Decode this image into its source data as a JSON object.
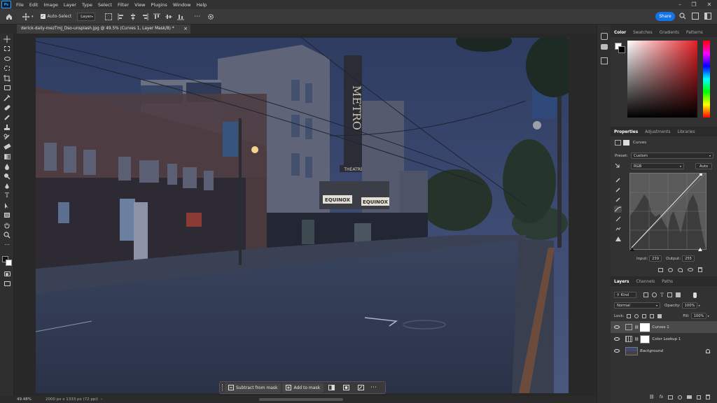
{
  "menubar": {
    "items": [
      "File",
      "Edit",
      "Image",
      "Layer",
      "Type",
      "Select",
      "Filter",
      "View",
      "Plugins",
      "Window",
      "Help"
    ]
  },
  "options": {
    "auto_select_label": "Auto-Select",
    "auto_select_value": "Layer",
    "share_label": "Share"
  },
  "document": {
    "tab_title": "derick-daily-mezTmJ_Dso-unsplash.jpg @ 49.5% (Curves 1, Layer Mask/8) *",
    "close_glyph": "×"
  },
  "canvas": {
    "theatre_marquee_1": "EQUINOX",
    "theatre_marquee_2": "EQUINOX",
    "metro_sign": "METRO",
    "theatre_sign": "THEATRE"
  },
  "context_bar": {
    "subtract_label": "Subtract from mask",
    "add_label": "Add to mask"
  },
  "status": {
    "zoom": "49.48%",
    "doc_info": "2000 px x 1333 px (72 ppi)"
  },
  "color_panel": {
    "tabs": [
      "Color",
      "Swatches",
      "Gradients",
      "Patterns"
    ],
    "active_tab": "Color"
  },
  "properties_panel": {
    "tabs": [
      "Properties",
      "Adjustments",
      "Libraries"
    ],
    "active_tab": "Properties",
    "type_label": "Curves",
    "preset_label": "Preset:",
    "preset_value": "Custom",
    "channel_value": "RGB",
    "auto_label": "Auto",
    "input_label": "Input:",
    "input_value": "239",
    "output_label": "Output:",
    "output_value": "255"
  },
  "layers_panel": {
    "tabs": [
      "Layers",
      "Channels",
      "Paths"
    ],
    "active_tab": "Layers",
    "filter_value": "Kind",
    "blend_mode": "Normal",
    "opacity_label": "Opacity:",
    "opacity_value": "100%",
    "lock_label": "Lock:",
    "fill_label": "Fill:",
    "fill_value": "100%",
    "layers": [
      {
        "name": "Curves 1",
        "selected": true
      },
      {
        "name": "Color Lookup 1",
        "selected": false
      },
      {
        "name": "Background",
        "selected": false
      }
    ]
  },
  "colors": {
    "accent": "#1473e6",
    "ui_dark": "#2b2b2b",
    "panel": "#323232",
    "sky": "#3a4a72"
  }
}
